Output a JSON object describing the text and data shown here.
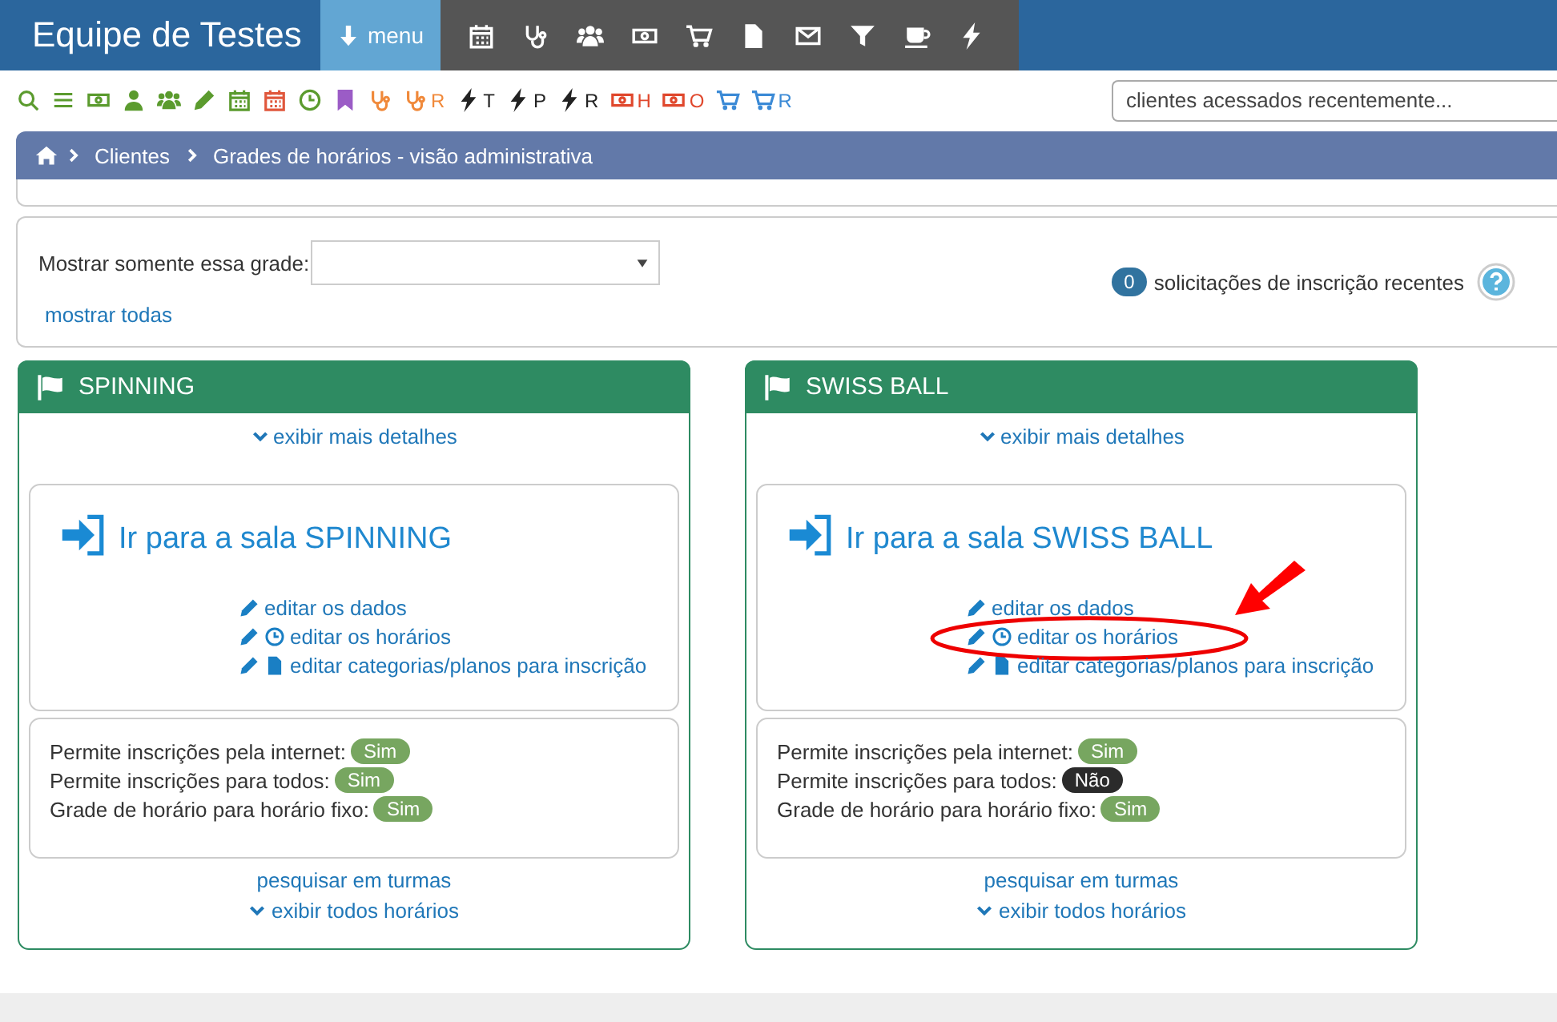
{
  "header": {
    "title": "Equipe de Testes",
    "menu_label": "menu"
  },
  "toolbar": [
    {
      "kind": "search",
      "color": "#5b9b2e"
    },
    {
      "kind": "list",
      "color": "#5b9b2e"
    },
    {
      "kind": "money",
      "color": "#5b9b2e"
    },
    {
      "kind": "user",
      "color": "#5b9b2e"
    },
    {
      "kind": "users",
      "color": "#5b9b2e"
    },
    {
      "kind": "pencil",
      "color": "#5b9b2e"
    },
    {
      "kind": "calendar",
      "color": "#5b9b2e"
    },
    {
      "kind": "calendar",
      "color": "#e0573c"
    },
    {
      "kind": "clock",
      "color": "#5b9b2e"
    },
    {
      "kind": "bookmark",
      "color": "#9b5cc6"
    },
    {
      "kind": "stethoscope",
      "color": "#f0893a"
    },
    {
      "kind": "stethoscope",
      "color": "#f0893a",
      "letter": "R"
    },
    {
      "kind": "bolt",
      "color": "#222222",
      "letter": "T"
    },
    {
      "kind": "bolt",
      "color": "#222222",
      "letter": "P"
    },
    {
      "kind": "bolt",
      "color": "#222222",
      "letter": "R"
    },
    {
      "kind": "money",
      "color": "#e0482d",
      "letter": "H"
    },
    {
      "kind": "money",
      "color": "#e0482d",
      "letter": "O"
    },
    {
      "kind": "cart",
      "color": "#3b8ad6"
    },
    {
      "kind": "cart",
      "color": "#3b8ad6",
      "letter": "R"
    }
  ],
  "recent_clients": {
    "placeholder": "clientes acessados recentemente..."
  },
  "breadcrumb": [
    "Clientes",
    "Grades de horários - visão administrativa"
  ],
  "filter": {
    "label": "Mostrar somente essa grade:",
    "show_all": "mostrar todas"
  },
  "requests": {
    "count": "0",
    "label": "solicitações de inscrição recentes"
  },
  "rooms": [
    {
      "name": "SPINNING",
      "details": "exibir mais detalhes",
      "enter": "Ir para a sala SPINNING",
      "links": [
        {
          "kind": "data",
          "label": "editar os dados",
          "highlighted": false
        },
        {
          "kind": "schedule",
          "label": "editar os horários",
          "highlighted": false
        },
        {
          "kind": "plans",
          "label": "editar categorias/planos para inscrição",
          "highlighted": false
        }
      ],
      "flags": [
        {
          "label": "Permite inscrições pela internet:",
          "value": "Sim",
          "on": true
        },
        {
          "label": "Permite inscrições para todos:",
          "value": "Sim",
          "on": true
        },
        {
          "label": "Grade de horário para horário fixo:",
          "value": "Sim",
          "on": true
        }
      ],
      "search": "pesquisar em turmas",
      "all": "exibir todos horários"
    },
    {
      "name": "SWISS BALL",
      "details": "exibir mais detalhes",
      "enter": "Ir para a sala SWISS BALL",
      "links": [
        {
          "kind": "data",
          "label": "editar os dados",
          "highlighted": false
        },
        {
          "kind": "schedule",
          "label": "editar os horários",
          "highlighted": true
        },
        {
          "kind": "plans",
          "label": "editar categorias/planos para inscrição",
          "highlighted": false
        }
      ],
      "flags": [
        {
          "label": "Permite inscrições pela internet:",
          "value": "Sim",
          "on": true
        },
        {
          "label": "Permite inscrições para todos:",
          "value": "Não",
          "on": false
        },
        {
          "label": "Grade de horário para horário fixo:",
          "value": "Sim",
          "on": true
        }
      ],
      "search": "pesquisar em turmas",
      "all": "exibir todos horários"
    }
  ]
}
